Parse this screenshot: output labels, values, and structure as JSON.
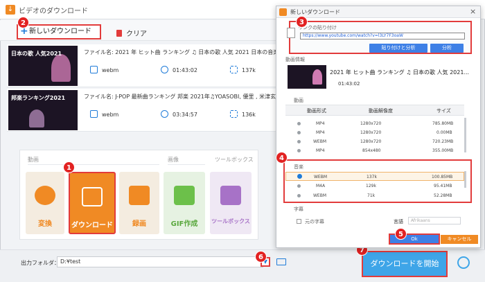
{
  "app": {
    "logo_glyph": "↓",
    "title": "ビデオのダウンロード"
  },
  "toolbar": {
    "new_download_label": "新しいダウンロード",
    "plus_glyph": "+",
    "clear_label": "クリア"
  },
  "badges": [
    "1",
    "2",
    "3",
    "4",
    "5",
    "6",
    "7"
  ],
  "tasks": [
    {
      "thumb_text": "日本の歌 人気2021",
      "filename": "ファイル名: 2021 年 ヒット曲 ランキング ♫ 日本の歌 人気 2021 日本の音楽 邦楽 100,000,000...",
      "format": "webm",
      "duration": "01:43:02",
      "size": "137k"
    },
    {
      "thumb_text": "邦楽ランキング2021",
      "filename": "ファイル名: J-POP 最新曲ランキング 邦楽 2021年♫YOASOBI, 優里 , 米津玄師, Official髭男dism, ...",
      "format": "webm",
      "duration": "03:34:57",
      "size": "136k"
    }
  ],
  "features": {
    "cat_video": "動画",
    "cat_image": "画像",
    "cat_tools": "ツールボックス",
    "tiles": [
      "変換",
      "ダウンロード",
      "録画",
      "GIF作成",
      "ツールボックス"
    ]
  },
  "bottom": {
    "output_label": "出力フォルダ：",
    "output_path": "D:¥test",
    "drop_glyph": "▼",
    "start_label": "ダウンロードを開始"
  },
  "dialog": {
    "title": "新しいダウンロード",
    "close_glyph": "×",
    "paste_label": "リンクの貼り付け",
    "url": "https://www.youtube.com/watch?v=l3LY7F3oaW",
    "paste_analyze_label": "貼り付けと分析",
    "analyze_label": "分析",
    "info_label": "動画情報",
    "info_title": "2021 年 ヒット曲 ランキング ♫ 日本の歌 人気 2021...",
    "info_duration": "01:43:02",
    "video_label": "動画",
    "video_headers": [
      "動画形式",
      "動画解像度",
      "サイズ"
    ],
    "video_rows": [
      [
        "MP4",
        "1280x720",
        "785.80MB"
      ],
      [
        "MP4",
        "1280x720",
        "0.00MB"
      ],
      [
        "WEBM",
        "1280x720",
        "720.23MB"
      ],
      [
        "MP4",
        "854x480",
        "355.00MB"
      ]
    ],
    "audio_label": "音楽",
    "audio_rows": [
      [
        "WEBM",
        "137k",
        "100.85MB"
      ],
      [
        "M4A",
        "129k",
        "95.41MB"
      ],
      [
        "WEBM",
        "71k",
        "52.28MB"
      ]
    ],
    "sub_label": "字幕",
    "sub_check_label": "元の字幕",
    "lang_label": "言語",
    "lang_value": "Afrikaans",
    "ok_label": "Ok",
    "cancel_label": "キャンセル"
  }
}
